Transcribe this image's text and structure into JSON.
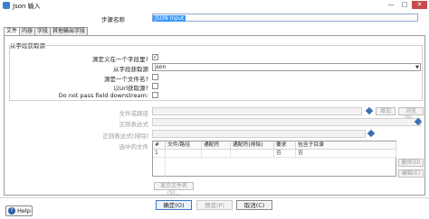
{
  "window": {
    "title": "Json 输入",
    "minimize": "—",
    "maximize": "□",
    "close": "✕"
  },
  "step": {
    "label": "步骤名称",
    "value": "JSON Input"
  },
  "tabs": [
    "文件",
    "内容",
    "字段",
    "其他输出字段"
  ],
  "source_group": {
    "title": "从字段获取源",
    "is_from_field_label": "源定义在一个字段里?",
    "is_from_field_checked": true,
    "field_source_label": "从字段获取源",
    "field_source_value": "json",
    "is_filename_label": "源是一个文件名?",
    "is_url_label": "以Url获取源?",
    "no_pass_label": "Do not pass field downstream:"
  },
  "file_section": {
    "filename_label": "文件或路径",
    "add_button": "增加",
    "browse_button": "浏览(B)...",
    "regex_label": "正则表达式",
    "exclude_regex_label": "正则表达式(排除)",
    "selected_files_label": "选中的文件",
    "columns": [
      "#",
      "文件/路径",
      "通配符",
      "通配符(排除)",
      "要求",
      "包含子目录"
    ],
    "row": [
      "1",
      "",
      "",
      "",
      "否",
      "否"
    ],
    "delete_button": "删除(D)",
    "edit_button": "编辑(E)",
    "show_files_button": "显示文件名(S)..."
  },
  "footer": {
    "help": "Help",
    "ok": "确定(O)",
    "preview": "预览(P)",
    "cancel": "取消(C)"
  }
}
